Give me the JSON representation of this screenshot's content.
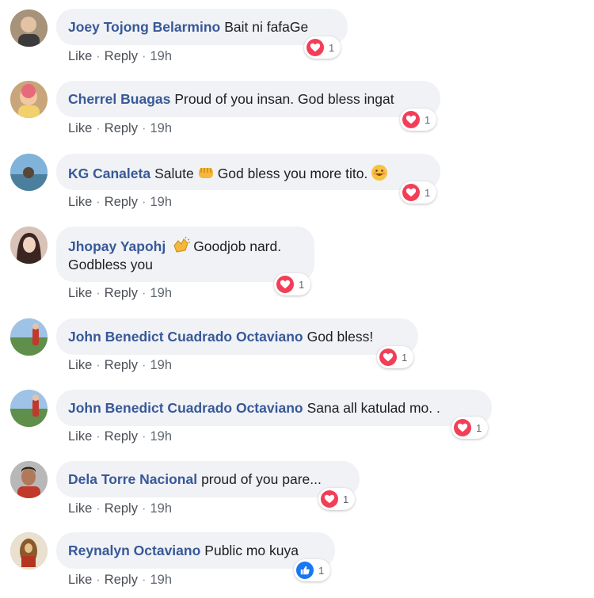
{
  "comments": [
    {
      "author": "Joey Tojong Belarmino",
      "text": "Bait ni fafaGe",
      "like": "Like",
      "reply": "Reply",
      "time": "19h",
      "reaction": "heart",
      "reaction_count": "1"
    },
    {
      "author": "Cherrel Buagas",
      "text": "Proud of you insan. God bless ingat",
      "like": "Like",
      "reply": "Reply",
      "time": "19h",
      "reaction": "heart",
      "reaction_count": "1"
    },
    {
      "author": "KG Canaleta",
      "text_before": "Salute",
      "emoji_1": "fist-emoji",
      "text_after": "God bless you more tito.",
      "emoji_2": "smile-emoji",
      "like": "Like",
      "reply": "Reply",
      "time": "19h",
      "reaction": "heart",
      "reaction_count": "1"
    },
    {
      "author": "Jhopay Yapohj",
      "emoji_1": "clap-emoji",
      "text_line1": "Goodjob nard.",
      "text_line2": "Godbless you",
      "like": "Like",
      "reply": "Reply",
      "time": "19h",
      "reaction": "heart",
      "reaction_count": "1"
    },
    {
      "author": "John Benedict Cuadrado Octaviano",
      "text": "God bless!",
      "like": "Like",
      "reply": "Reply",
      "time": "19h",
      "reaction": "heart",
      "reaction_count": "1"
    },
    {
      "author": "John Benedict Cuadrado Octaviano",
      "text": "Sana all katulad mo. .",
      "like": "Like",
      "reply": "Reply",
      "time": "19h",
      "reaction": "heart",
      "reaction_count": "1"
    },
    {
      "author": "Dela Torre Nacional",
      "text": "proud of you pare...",
      "like": "Like",
      "reply": "Reply",
      "time": "19h",
      "reaction": "heart",
      "reaction_count": "1"
    },
    {
      "author": "Reynalyn Octaviano",
      "text": "Public mo kuya",
      "like": "Like",
      "reply": "Reply",
      "time": "19h",
      "reaction": "like",
      "reaction_count": "1"
    }
  ],
  "separator": "·",
  "colors": {
    "author": "#385898",
    "bubble": "#f0f2f5",
    "heart": "#f33e58",
    "like": "#1877f2",
    "meta": "#606770"
  }
}
